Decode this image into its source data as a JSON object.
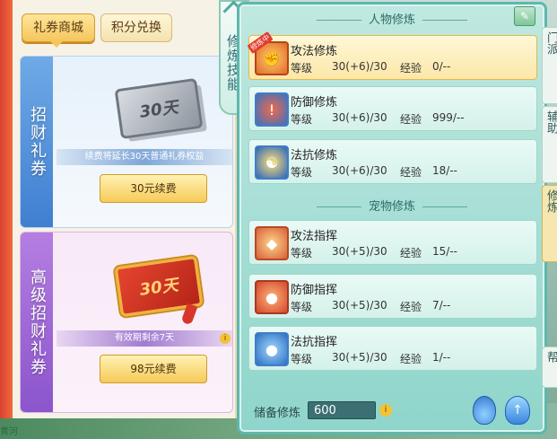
{
  "shop": {
    "tabs": [
      {
        "label": "礼券商城",
        "active": true
      },
      {
        "label": "积分兑换",
        "active": false
      }
    ],
    "cards": [
      {
        "side_title": "招财礼券",
        "ticket_text": "30天",
        "note": "续费将延长30天普通礼券权益",
        "button": "30元续费"
      },
      {
        "side_title": "高级招财礼券",
        "ticket_text": "30天",
        "note": "有效期剩余7天",
        "button": "98元续费"
      }
    ]
  },
  "skill_tab": {
    "label": "修炼技能"
  },
  "cultivation": {
    "character_section": "人物修炼",
    "pet_section": "宠物修炼",
    "level_label": "等级",
    "exp_label": "经验",
    "character_rows": [
      {
        "name": "攻法修炼",
        "level": "30(+6)/30",
        "exp": "0/--",
        "selected": true,
        "badge": "修炼中",
        "icon": "attack-magic-icon"
      },
      {
        "name": "防御修炼",
        "level": "30(+6)/30",
        "exp": "999/--",
        "selected": false,
        "icon": "shield-icon"
      },
      {
        "name": "法抗修炼",
        "level": "30(+6)/30",
        "exp": "18/--",
        "selected": false,
        "icon": "yin-yang-icon"
      }
    ],
    "pet_rows": [
      {
        "name": "攻法指挥",
        "level": "30(+5)/30",
        "exp": "15/--",
        "icon": "paw-attack-icon"
      },
      {
        "name": "防御指挥",
        "level": "30(+5)/30",
        "exp": "7/--",
        "icon": "paw-defense-icon"
      },
      {
        "name": "法抗指挥",
        "level": "30(+5)/30",
        "exp": "1/--",
        "icon": "paw-resist-icon"
      }
    ],
    "reserve_label": "储备修炼",
    "reserve_value": "600"
  },
  "side_tabs": [
    "门派",
    "辅助",
    "修炼",
    "帮"
  ],
  "corner_text": "青河"
}
